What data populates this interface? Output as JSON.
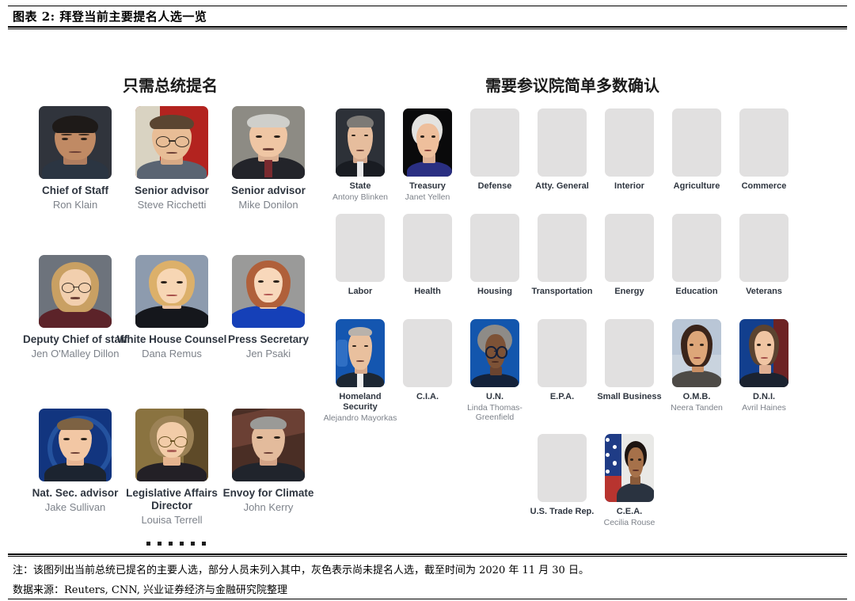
{
  "title": "图表 2: 拜登当前主要提名人选一览",
  "sections": {
    "left_header": "只需总统提名",
    "right_header": "需要参议院简单多数确认"
  },
  "presidential_appointees": [
    {
      "title": "Chief of Staff",
      "name": "Ron Klain"
    },
    {
      "title": "Senior advisor",
      "name": "Steve Ricchetti"
    },
    {
      "title": "Senior advisor",
      "name": "Mike Donilon"
    },
    {
      "title": "Deputy Chief of staff",
      "name": "Jen O'Malley Dillon"
    },
    {
      "title": "White House Counsel",
      "name": "Dana Remus"
    },
    {
      "title": "Press Secretary",
      "name": "Jen Psaki"
    },
    {
      "title": "Nat. Sec. advisor",
      "name": "Jake Sullivan"
    },
    {
      "title": "Legislative Affairs Director",
      "name": "Louisa Terrell"
    },
    {
      "title": "Envoy for Climate",
      "name": "John Kerry"
    }
  ],
  "senate_confirmed": [
    {
      "title": "State",
      "name": "Antony Blinken",
      "filled": true
    },
    {
      "title": "Treasury",
      "name": "Janet Yellen",
      "filled": true
    },
    {
      "title": "Defense",
      "name": "",
      "filled": false
    },
    {
      "title": "Atty. General",
      "name": "",
      "filled": false
    },
    {
      "title": "Interior",
      "name": "",
      "filled": false
    },
    {
      "title": "Agriculture",
      "name": "",
      "filled": false
    },
    {
      "title": "Commerce",
      "name": "",
      "filled": false
    },
    {
      "title": "Labor",
      "name": "",
      "filled": false
    },
    {
      "title": "Health",
      "name": "",
      "filled": false
    },
    {
      "title": "Housing",
      "name": "",
      "filled": false
    },
    {
      "title": "Transportation",
      "name": "",
      "filled": false
    },
    {
      "title": "Energy",
      "name": "",
      "filled": false
    },
    {
      "title": "Education",
      "name": "",
      "filled": false
    },
    {
      "title": "Veterans",
      "name": "",
      "filled": false
    },
    {
      "title": "Homeland Security",
      "name": "Alejandro Mayorkas",
      "filled": true
    },
    {
      "title": "C.I.A.",
      "name": "",
      "filled": false
    },
    {
      "title": "U.N.",
      "name": "Linda Thomas-Greenfield",
      "filled": true
    },
    {
      "title": "E.P.A.",
      "name": "",
      "filled": false
    },
    {
      "title": "Small Business",
      "name": "",
      "filled": false
    },
    {
      "title": "O.M.B.",
      "name": "Neera Tanden",
      "filled": true
    },
    {
      "title": "D.N.I.",
      "name": "Avril Haines",
      "filled": true
    },
    {
      "title": "U.S. Trade Rep.",
      "name": "",
      "filled": false
    },
    {
      "title": "C.E.A.",
      "name": "Cecilia Rouse",
      "filled": true
    }
  ],
  "ellipsis": "······",
  "footer": {
    "note": "注：该图列出当前总统已提名的主要人选，部分人员未列入其中，灰色表示尚未提名人选，截至时间为 2020 年 11 月 30 日。",
    "source": "数据来源：Reuters, CNN, 兴业证券经济与金融研究院整理"
  },
  "colors": {
    "placeholder_gray": "#e1e0e0",
    "title_text": "#2f3640",
    "name_text": "#7d828a",
    "rule": "#000000"
  }
}
